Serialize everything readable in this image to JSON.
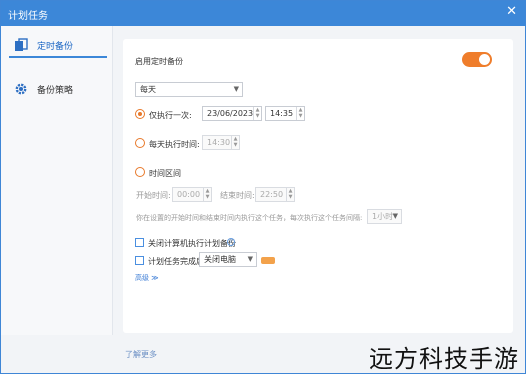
{
  "window": {
    "title": "计划任务",
    "close_symbol": "✕"
  },
  "sidebar": {
    "items": [
      {
        "label": "定时备份",
        "icon": "backup-icon",
        "active": true
      },
      {
        "label": "备份策略",
        "icon": "gear-icon",
        "active": false
      }
    ]
  },
  "main": {
    "enable_label": "启用定时备份",
    "enable_on": true,
    "frequency": {
      "value": "每天",
      "options": [
        "每天"
      ]
    },
    "once": {
      "label": "仅执行一次:",
      "date": "23/06/2023",
      "time": "14:35",
      "selected": true
    },
    "daily": {
      "label": "每天执行时间:",
      "time": "14:30",
      "selected": false
    },
    "period": {
      "label": "时间区间",
      "selected": false,
      "start_label": "开始时间:",
      "start": "00:00",
      "end_label": "结束时间:",
      "end": "22:50"
    },
    "interval": {
      "label": "你在设置的开始时间和结束时间内执行这个任务，每次执行这个任务间隔:",
      "value": "1小时"
    },
    "shutdown": {
      "label": "关闭计算机执行计划备份"
    },
    "after": {
      "label": "计划任务完成后",
      "value": "关闭电脑"
    },
    "advanced_label": "高级 ≫"
  },
  "footer": {
    "link": "了解更多"
  },
  "watermark": "远方科技手游"
}
